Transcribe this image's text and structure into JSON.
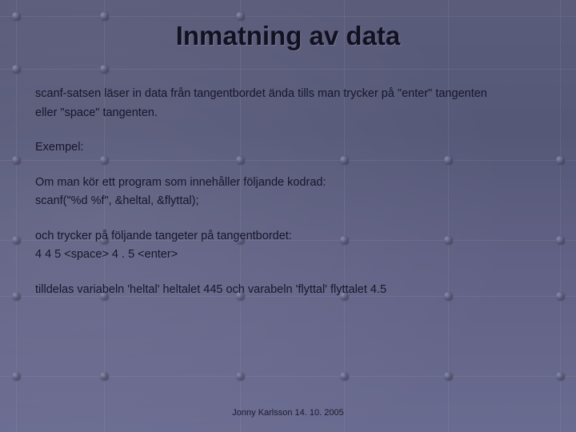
{
  "title": "Inmatning av data",
  "body": {
    "intro1": "scanf-satsen läser in data från tangentbordet ända tills man trycker på \"enter\" tangenten",
    "intro2": "eller \"space\" tangenten.",
    "exempel_label": "Exempel:",
    "ex_line1": "Om man kör ett program som innehåller följande kodrad:",
    "ex_code": "scanf(\"%d %f\", &heltal, &flyttal);",
    "ex_line2": "och trycker på följande tangeter på tangentbordet:",
    "ex_keys": "4 4 5 <space> 4 . 5 <enter>",
    "ex_line3": "tilldelas variabeln 'heltal' heltalet 445 och varabeln 'flyttal' flyttalet 4.5"
  },
  "footer": "Jonny Karlsson 14. 10. 2005"
}
